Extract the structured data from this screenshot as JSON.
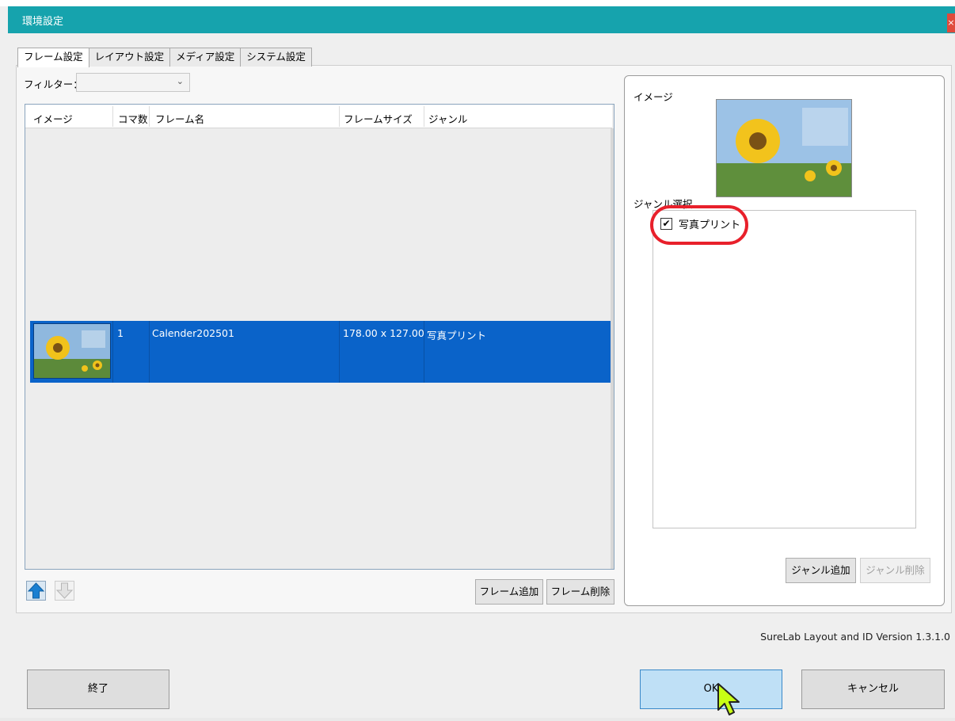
{
  "window": {
    "title": "環境設定",
    "close_symbol": "×"
  },
  "tabs": [
    {
      "label": "フレーム設定",
      "active": true
    },
    {
      "label": "レイアウト設定"
    },
    {
      "label": "メディア設定"
    },
    {
      "label": "システム設定"
    }
  ],
  "filter": {
    "label": "フィルター：",
    "value": ""
  },
  "table": {
    "columns": [
      "イメージ",
      "コマ数",
      "フレーム名",
      "フレームサイズ",
      "ジャンル"
    ],
    "rows": [
      {
        "frames": "1",
        "name": "Calender202501",
        "size": "178.00 x 127.00",
        "genre": "写真プリント",
        "selected": true
      }
    ]
  },
  "list_buttons": {
    "add": "フレーム追加",
    "delete": "フレーム削除"
  },
  "right_panel": {
    "image_label": "イメージ",
    "genre_label": "ジャンル選択",
    "genres": [
      {
        "label": "写真プリント",
        "checked": true,
        "check_mark": "✔"
      }
    ],
    "add_genre": "ジャンル追加",
    "delete_genre": "ジャンル削除"
  },
  "version": "SureLab Layout and ID Version 1.3.1.0",
  "footer": {
    "exit": "終了",
    "ok": "OK",
    "cancel": "キャンセル"
  },
  "colors": {
    "titlebar": "#16a3ad",
    "selection": "#0a63c9",
    "highlight": "#e8202b",
    "ok_button": "#bfe0f6"
  }
}
